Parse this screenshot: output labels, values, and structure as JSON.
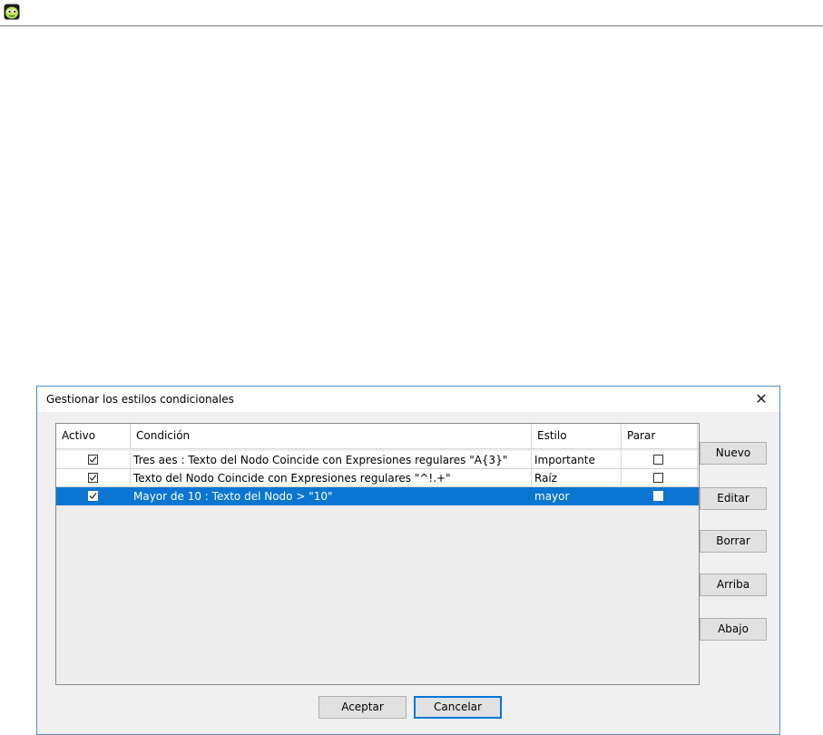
{
  "app": {
    "icon": "freeplane-app-icon"
  },
  "dialog": {
    "title": "Gestionar los estilos condicionales",
    "close_glyph": "✕",
    "table": {
      "columns": [
        "Activo",
        "Condición",
        "Estilo",
        "Parar"
      ],
      "rows": [
        {
          "active": true,
          "condition": "Tres aes : Texto del Nodo Coincide con Expresiones regulares \"A{3}\"",
          "style": "Importante",
          "stop": false,
          "selected": false
        },
        {
          "active": true,
          "condition": "Texto del Nodo Coincide con Expresiones regulares \"^!.+\"",
          "style": "Raíz",
          "stop": false,
          "selected": false
        },
        {
          "active": true,
          "condition": "Mayor de 10 : Texto del Nodo > \"10\"",
          "style": "mayor",
          "stop": false,
          "selected": true
        }
      ]
    },
    "side_buttons": [
      "Nuevo",
      "Editar",
      "Borrar",
      "Arriba",
      "Abajo"
    ],
    "bottom_buttons": {
      "accept": "Aceptar",
      "cancel": "Cancelar"
    },
    "colors": {
      "selection": "#0a76d2",
      "focus_border": "#0078d7",
      "dialog_border": "#4a90d9"
    }
  }
}
